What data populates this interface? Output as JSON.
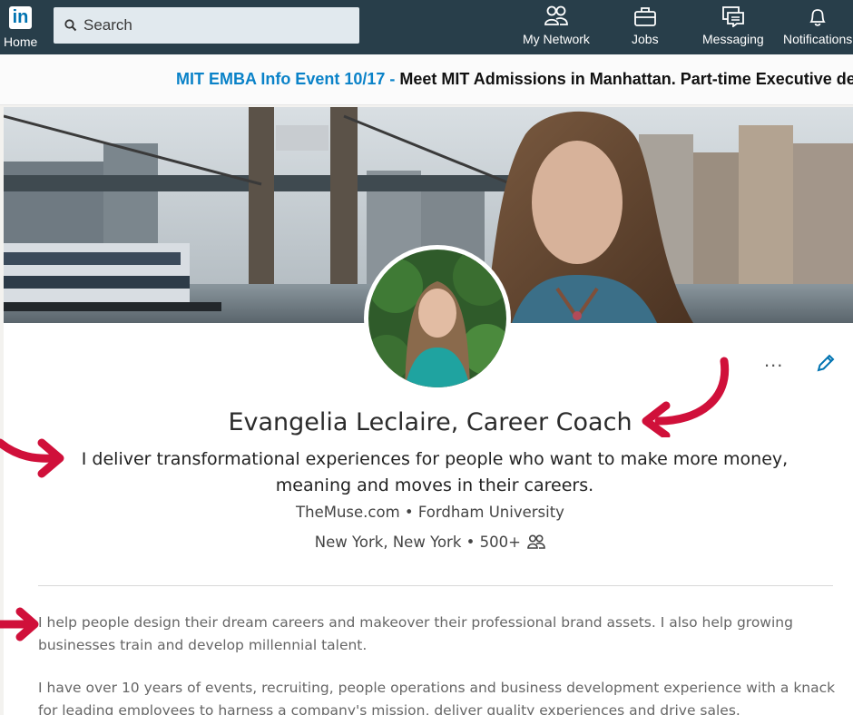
{
  "nav": {
    "logo": "in",
    "home": "Home",
    "search_placeholder": "Search",
    "items": [
      {
        "label": "My Network",
        "icon": "people-icon"
      },
      {
        "label": "Jobs",
        "icon": "briefcase-icon"
      },
      {
        "label": "Messaging",
        "icon": "chat-icon"
      },
      {
        "label": "Notifications",
        "icon": "bell-icon"
      }
    ]
  },
  "ad": {
    "link_text": "MIT EMBA Info Event 10/17 -",
    "text": " Meet MIT Admissions in Manhattan. Part-time Executive de"
  },
  "profile": {
    "name": "Evangelia Leclaire, Career Coach",
    "headline": "I deliver transformational experiences for people who want to make more money, meaning and moves in their careers.",
    "meta": "TheMuse.com • Fordham University",
    "location": "New York, New York • 500+",
    "more_label": "...",
    "summary": [
      "I help people design their dream careers and makeover their professional brand assets. I also help growing businesses train and develop millennial talent.",
      "I have over 10 years of events, recruiting, people operations and business development experience with a knack for leading employees to harness a company's mission, deliver quality experiences and drive sales."
    ]
  },
  "colors": {
    "nav_bg": "#283e4a",
    "link_blue": "#0a82c8",
    "arrow_red": "#d0103a",
    "edit_blue": "#0073b1"
  }
}
